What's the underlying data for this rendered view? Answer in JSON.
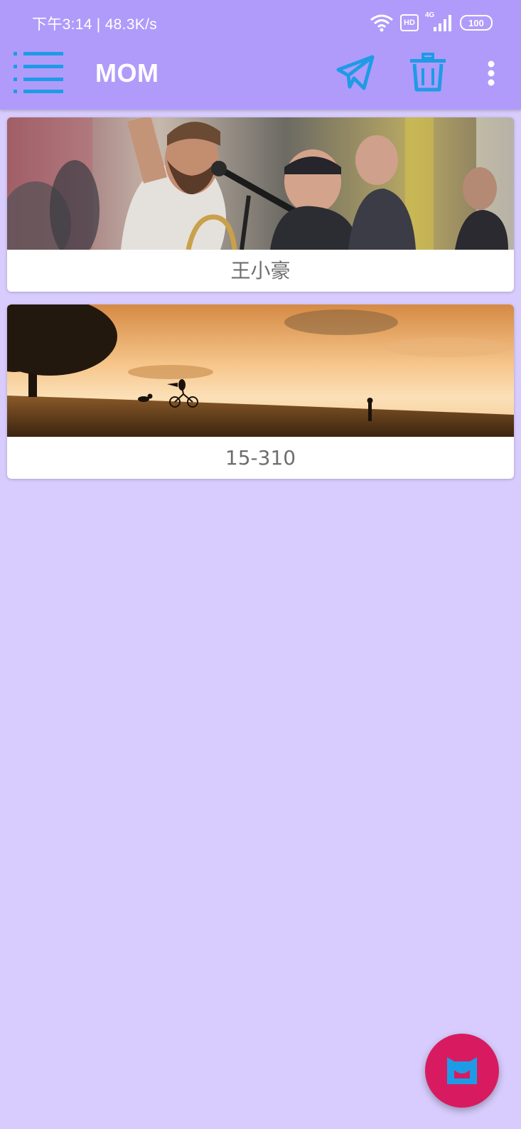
{
  "status_bar": {
    "time_speed": "下午3:14 | 48.3K/s",
    "hd_label": "HD",
    "network_label": "4G",
    "battery": "100"
  },
  "app_bar": {
    "title": "MOM",
    "icons": [
      "menu-icon",
      "send-icon",
      "delete-icon",
      "more-vert-icon"
    ],
    "icon_color": "#1e9be6"
  },
  "cards": [
    {
      "label": "王小豪",
      "image": "street-musician-photo"
    },
    {
      "label": "15-310",
      "image": "sunset-field-photo"
    }
  ],
  "fab": {
    "icon": "cat-face-icon",
    "color": "#d81b60"
  },
  "colors": {
    "header": "#b09bfa",
    "background": "#d7ccfd"
  }
}
